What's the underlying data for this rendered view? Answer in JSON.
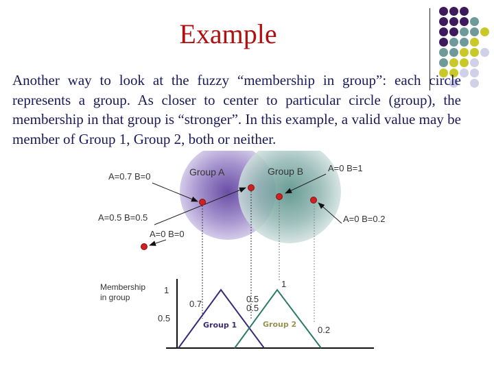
{
  "slide": {
    "title": "Example",
    "body": "Another way to look at the fuzzy “membership in group”: each circle represents a group. As closer to center to particular circle (group), the membership in that group is “stronger”. In this example, a valid value may be member of Group 1, Group 2, both or neither."
  },
  "colors": {
    "title": "#b01010",
    "body_text": "#1a1a5a",
    "purple": "#3d1a5c",
    "teal": "#6e9a9a",
    "olive": "#c8c828",
    "lavender": "#d0d0e8",
    "point": "#cc2222",
    "group1_line": "#3a2a78",
    "group2_line": "#2a7a6a"
  },
  "decor_dots": [
    [
      "purple",
      "purple",
      "purple",
      null,
      null
    ],
    [
      "purple",
      "purple",
      "purple",
      "teal",
      null
    ],
    [
      "purple",
      "purple",
      "teal",
      "teal",
      "olive"
    ],
    [
      "purple",
      "teal",
      "teal",
      "olive",
      null
    ],
    [
      "teal",
      "teal",
      "olive",
      "olive",
      "lavender"
    ],
    [
      "teal",
      "olive",
      "olive",
      "lavender",
      null
    ],
    [
      "olive",
      "olive",
      "lavender",
      "lavender",
      null
    ],
    [
      null,
      "lavender",
      null,
      "lavender",
      null
    ]
  ],
  "diagram": {
    "circles": {
      "group_a_label": "Group A",
      "group_b_label": "Group B"
    },
    "points": [
      {
        "label": "A=0.7 B=0",
        "a": 0.7,
        "b": 0
      },
      {
        "label": "A=0.5 B=0.5",
        "a": 0.5,
        "b": 0.5
      },
      {
        "label": "A=0 B=0",
        "a": 0,
        "b": 0
      },
      {
        "label": "A=0 B=1",
        "a": 0,
        "b": 1
      },
      {
        "label": "A=0 B=0.2",
        "a": 0,
        "b": 0.2
      }
    ],
    "membership_chart": {
      "ylabel_line1": "Membership",
      "ylabel_line2": "in group",
      "ytick_1": "1",
      "ytick_05": "0.5",
      "group1_label": "Group 1",
      "group2_label": "Group 2",
      "annotations": {
        "a07": "0.7",
        "a05": "0.5",
        "b05": "0.5",
        "b1": "1",
        "b02": "0.2"
      }
    }
  }
}
